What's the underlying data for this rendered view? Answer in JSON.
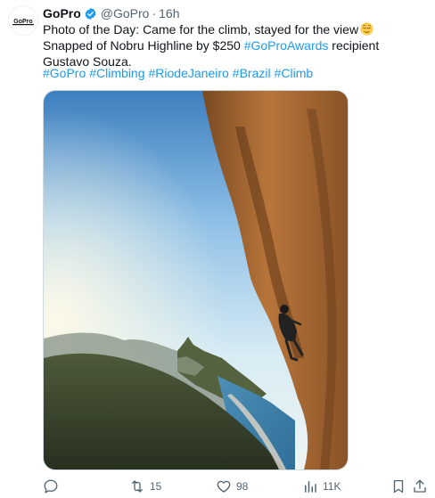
{
  "author": {
    "name": "GoPro",
    "handle": "@GoPro",
    "separator": "·",
    "time": "16h",
    "avatar_text": "GoPro"
  },
  "text": {
    "part1": "Photo of the Day: Came for the climb, stayed for the view",
    "emoji": "relieved-face",
    "part2": " Snapped of Nobru Highline by $250 ",
    "link": "#GoProAwards",
    "part3": " recipient Gustavo Souza."
  },
  "hashtags": [
    "#GoPro",
    "#Climbing",
    "#RiodeJaneiro",
    "#Brazil",
    "#Climb"
  ],
  "actions": {
    "reply_count": "",
    "retweet_count": "15",
    "like_count": "98",
    "views_count": "11K"
  },
  "colors": {
    "link": "#1d9bf0",
    "muted": "#536471",
    "verified": "#1d9bf0"
  },
  "icons": [
    "verified-badge-icon",
    "reply-icon",
    "retweet-icon",
    "like-icon",
    "views-icon",
    "bookmark-icon",
    "share-icon"
  ]
}
